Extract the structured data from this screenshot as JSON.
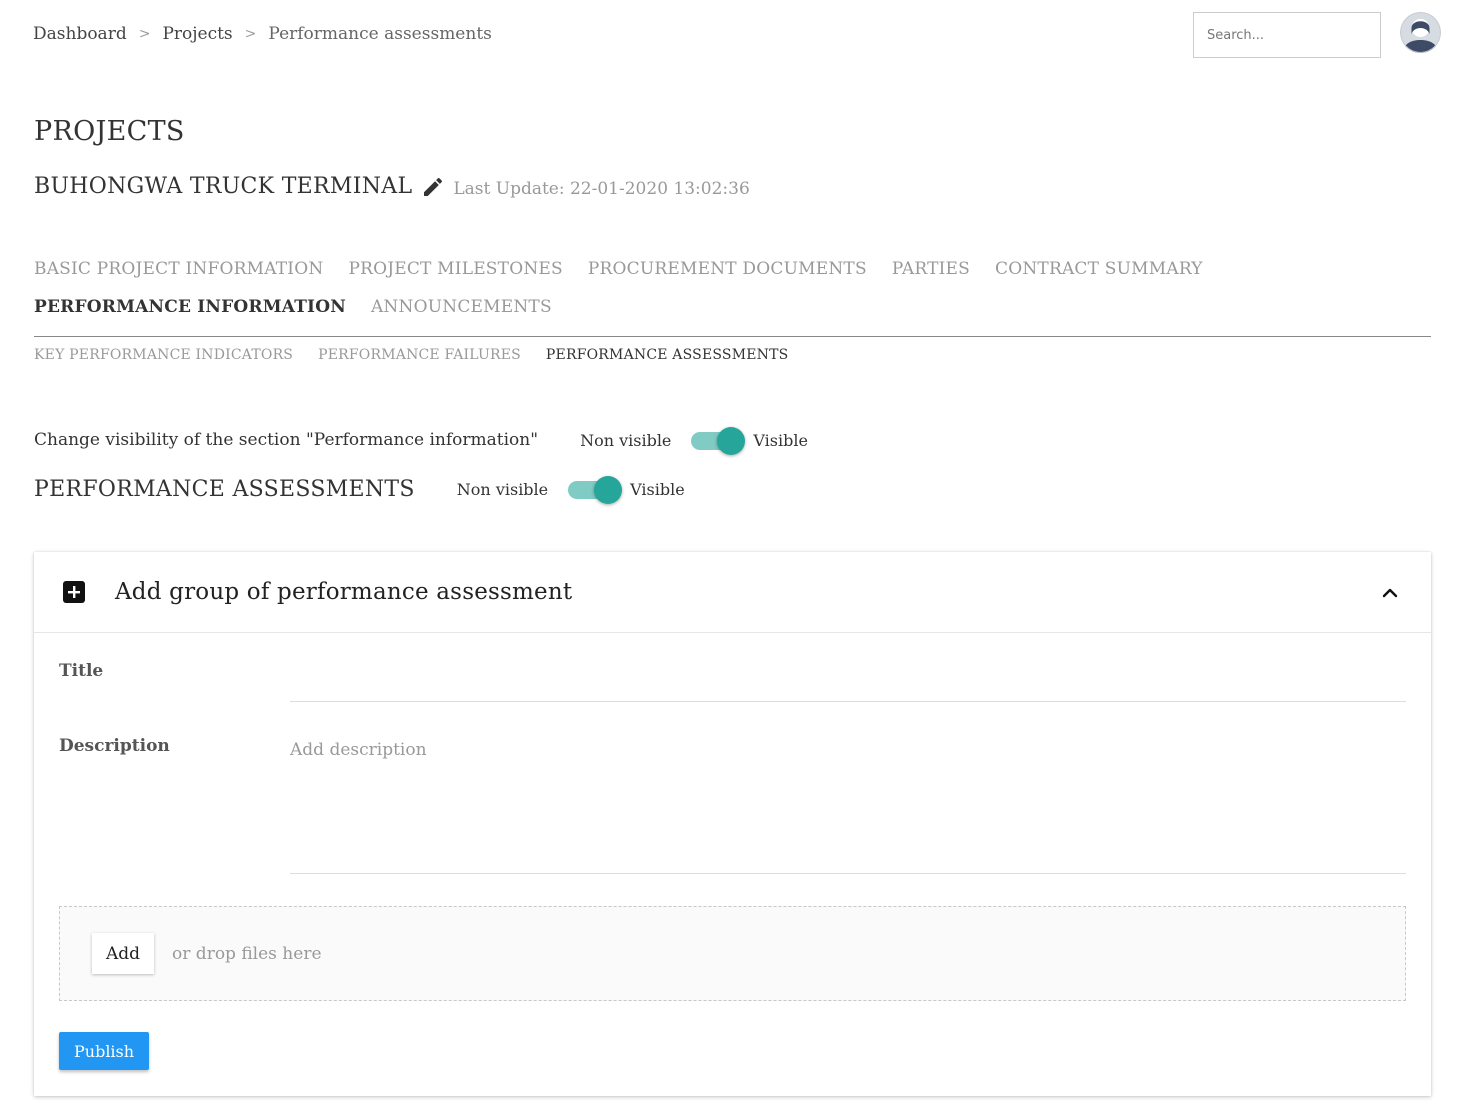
{
  "breadcrumb": {
    "items": [
      "Dashboard",
      "Projects",
      "Performance assessments"
    ],
    "separator": ">"
  },
  "search": {
    "placeholder": "Search...",
    "value": ""
  },
  "user": {
    "avatar_icon": "user-avatar-icon"
  },
  "page": {
    "title": "PROJECTS",
    "project_name": "BUHONGWA TRUCK TERMINAL",
    "edit_icon": "pencil-icon",
    "last_update": "Last Update: 22-01-2020 13:02:36"
  },
  "tabs": {
    "items": [
      "BASIC PROJECT INFORMATION",
      "PROJECT MILESTONES",
      "PROCUREMENT DOCUMENTS",
      "PARTIES",
      "CONTRACT SUMMARY",
      "PERFORMANCE INFORMATION",
      "ANNOUNCEMENTS"
    ],
    "active": "PERFORMANCE INFORMATION"
  },
  "subtabs": {
    "items": [
      "KEY PERFORMANCE INDICATORS",
      "PERFORMANCE FAILURES",
      "PERFORMANCE ASSESSMENTS"
    ],
    "active": "PERFORMANCE ASSESSMENTS"
  },
  "visibility": {
    "section_label": "Change visibility of the section \"Performance information\"",
    "section_heading": "PERFORMANCE ASSESSMENTS",
    "off_label": "Non visible",
    "on_label": "Visible",
    "section_visible": true,
    "assessments_visible": true
  },
  "card": {
    "icon": "plus-box-icon",
    "title": "Add group of performance assessment",
    "collapse_icon": "chevron-up-icon",
    "title_label": "Title",
    "title_value": "",
    "description_label": "Description",
    "description_placeholder": "Add description",
    "add_button": "Add",
    "drop_hint": "or drop files here",
    "publish_button": "Publish"
  },
  "colors": {
    "toggle_track": "#80cbc4",
    "toggle_knob": "#26a69a",
    "publish": "#2196f3"
  }
}
